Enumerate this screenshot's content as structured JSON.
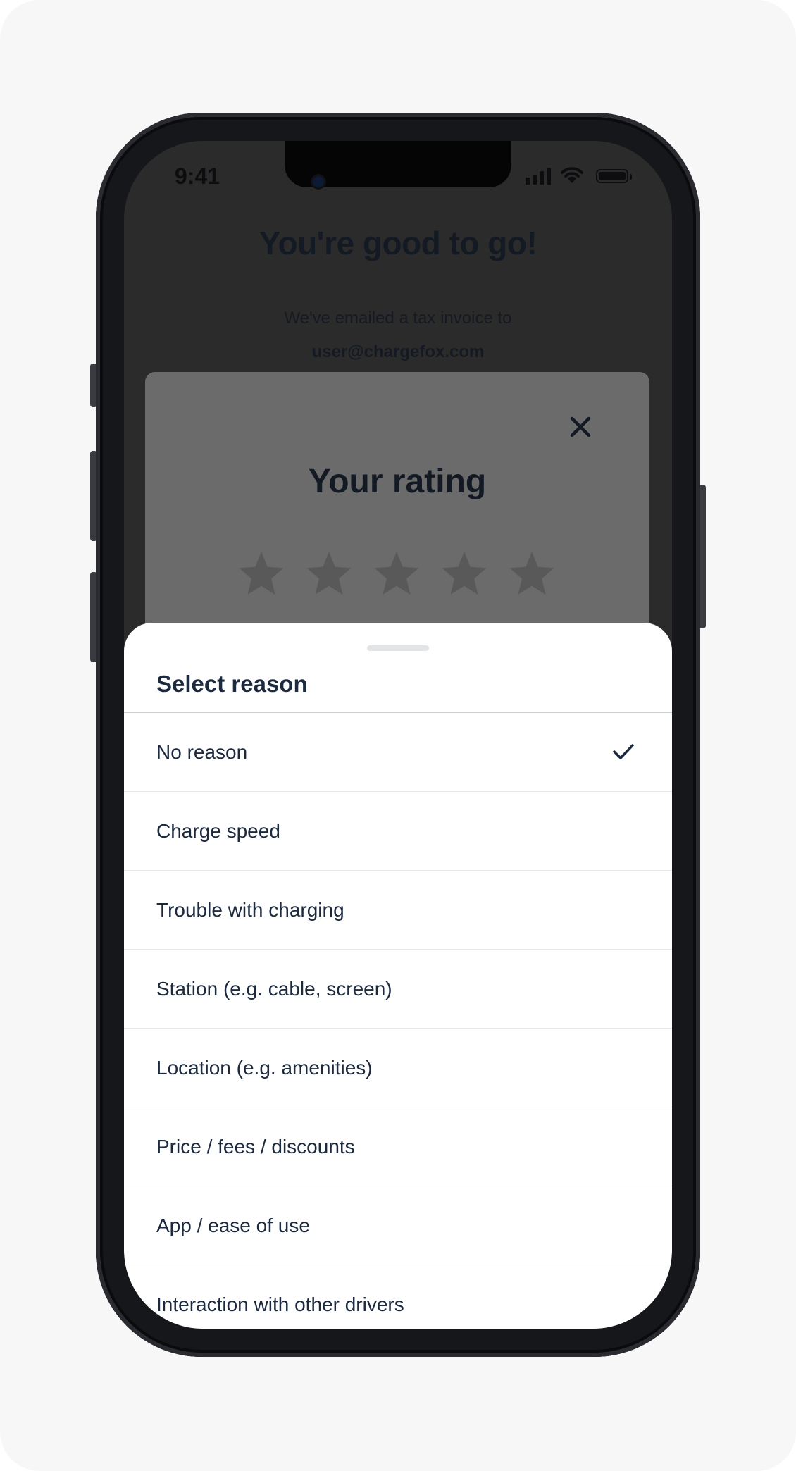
{
  "status_bar": {
    "time": "9:41",
    "icons": [
      "cellular-signal-icon",
      "wifi-icon",
      "battery-icon"
    ]
  },
  "backdrop": {
    "heading": "You're good to go!",
    "invoice_text": "We've emailed a tax invoice to",
    "email": "user@chargefox.com"
  },
  "rating_card": {
    "title": "Your rating",
    "close_icon": "close-icon",
    "stars_total": 5,
    "stars_filled": 0
  },
  "sheet": {
    "title": "Select reason",
    "selected_index": 0,
    "options": [
      {
        "label": "No reason"
      },
      {
        "label": "Charge speed"
      },
      {
        "label": "Trouble with charging"
      },
      {
        "label": "Station (e.g. cable, screen)"
      },
      {
        "label": "Location (e.g. amenities)"
      },
      {
        "label": "Price / fees / discounts"
      },
      {
        "label": "App / ease of use"
      },
      {
        "label": "Interaction with other drivers"
      }
    ]
  },
  "colors": {
    "text_primary": "#1c2a3f",
    "backdrop": "#2b2b2b",
    "card_dimmed": "#6b6b6b",
    "sheet_bg": "#ffffff",
    "page_bg": "#f7f7f7"
  }
}
